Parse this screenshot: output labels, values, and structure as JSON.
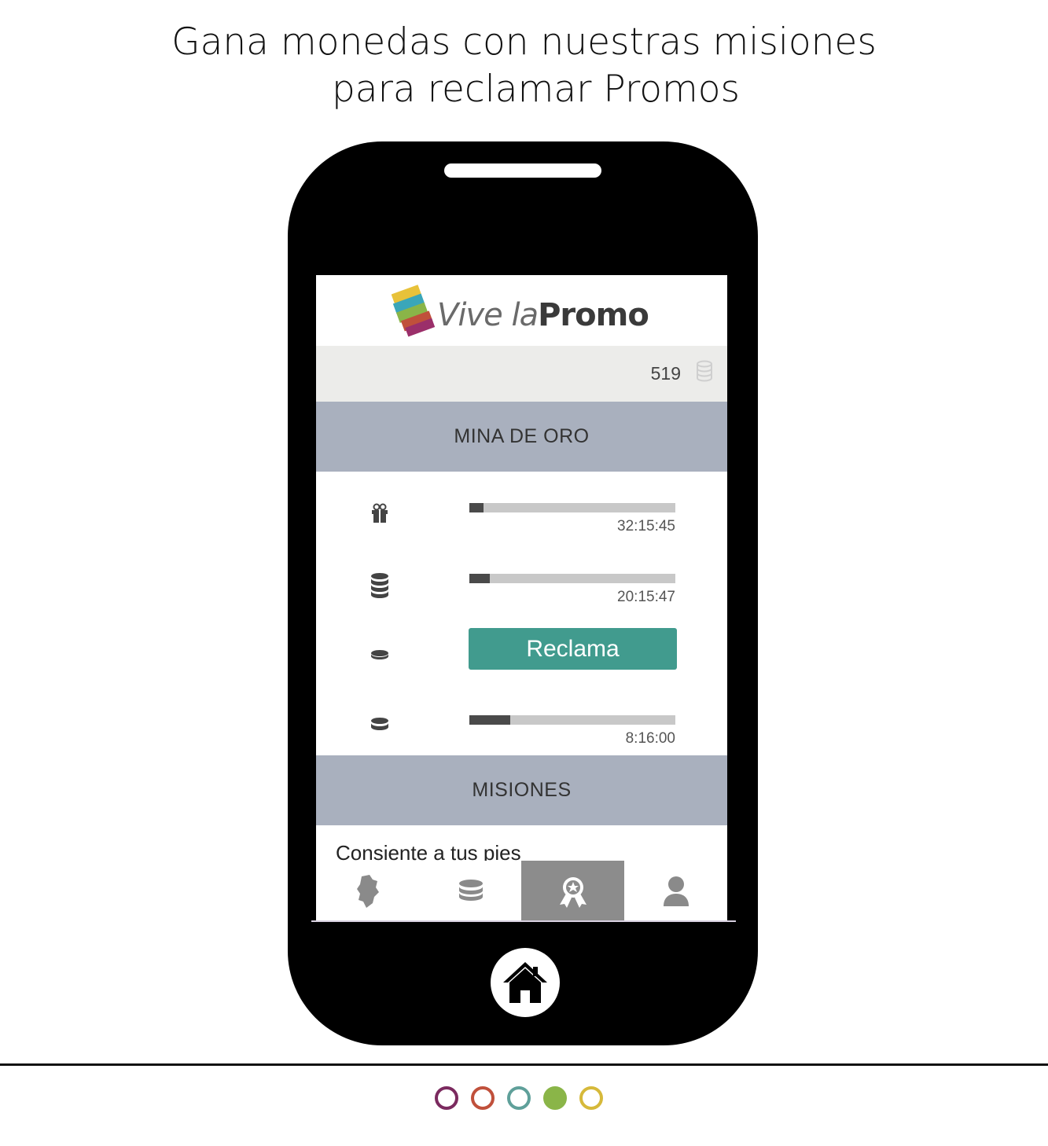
{
  "headline": {
    "line1": "Gana monedas con nuestras misiones",
    "line2": "para reclamar Promos"
  },
  "app": {
    "logo": {
      "word1": "Vive la",
      "word2": "Promo"
    },
    "coin_balance": "519",
    "mine": {
      "title": "MINA DE ORO",
      "rows": [
        {
          "icon": "gift-icon",
          "progress": 0.07,
          "timer": "32:15:45"
        },
        {
          "icon": "coin-stack-icon",
          "progress": 0.1,
          "timer": "20:15:47"
        },
        {
          "icon": "single-coin-icon",
          "button_label": "Reclama"
        },
        {
          "icon": "double-coin-icon",
          "progress": 0.2,
          "timer": "8:16:00"
        }
      ]
    },
    "missions": {
      "title": "MISIONES",
      "first_item": "Consiente a tus pies"
    },
    "tabs": [
      {
        "icon": "map-icon",
        "active": false
      },
      {
        "icon": "coins-icon",
        "active": false
      },
      {
        "icon": "award-badge-icon",
        "active": true
      },
      {
        "icon": "user-icon",
        "active": false
      }
    ]
  },
  "pager": {
    "dot_colors": [
      "#7b2a5f",
      "#c0503b",
      "#5fa09a",
      "#8ab548",
      "#d6b93a"
    ],
    "active_index": 3
  }
}
